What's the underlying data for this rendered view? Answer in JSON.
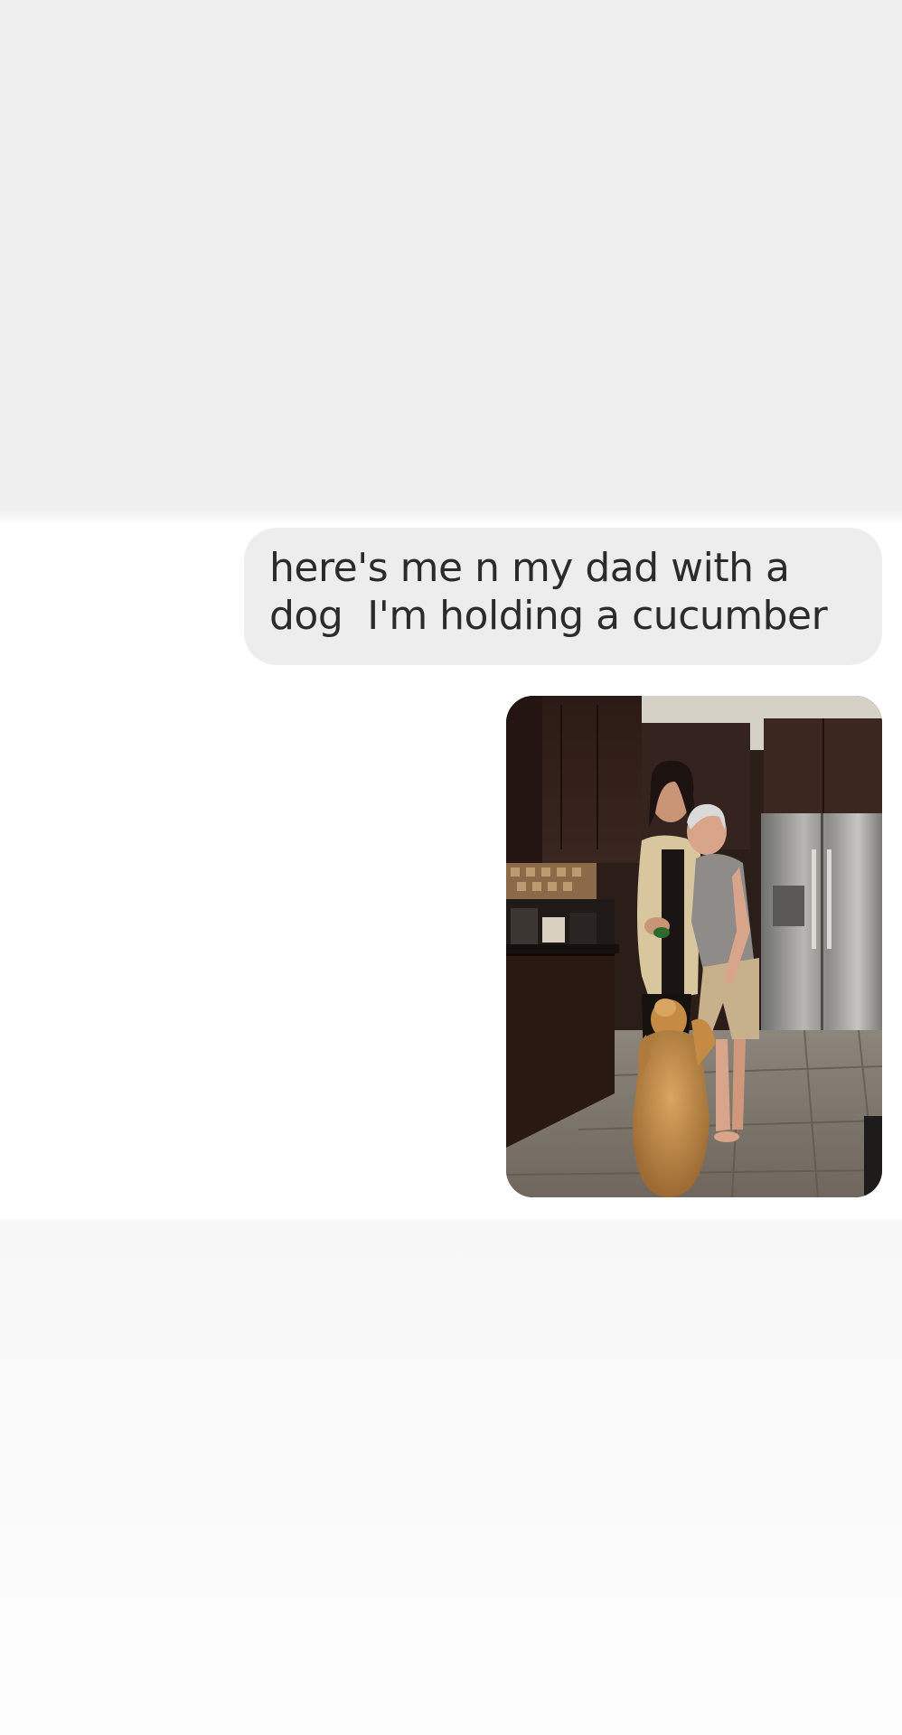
{
  "conversation": {
    "messages": [
      {
        "type": "text",
        "direction": "outgoing",
        "text": "here's me n my dad with a\ndog  I'm holding a cucumber"
      },
      {
        "type": "image",
        "direction": "outgoing",
        "image_content": "photo"
      }
    ]
  },
  "colors": {
    "top_band": "#efefef",
    "conversation_bg": "#ffffff",
    "bubble_bg": "#ededed",
    "bubble_text": "#2b2b2b",
    "bottom_band": "#f9f9f9"
  }
}
